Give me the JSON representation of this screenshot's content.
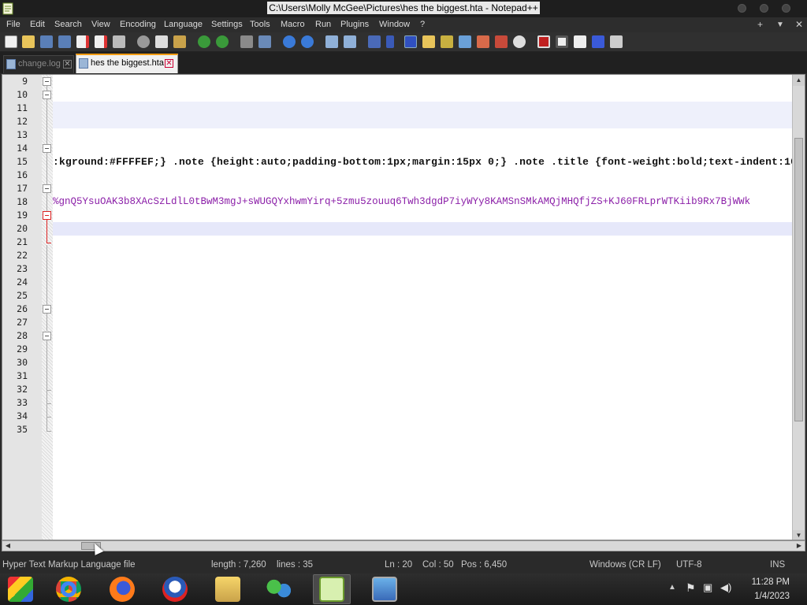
{
  "window": {
    "title": "C:\\Users\\Molly McGee\\Pictures\\hes the biggest.hta - Notepad++"
  },
  "menu": {
    "items": [
      "File",
      "Edit",
      "Search",
      "View",
      "Encoding",
      "Language",
      "Settings",
      "Tools",
      "Macro",
      "Run",
      "Plugins",
      "Window",
      "?"
    ],
    "right": [
      "+",
      "▼",
      "✕"
    ]
  },
  "tabs": [
    {
      "label": "change.log",
      "active": false
    },
    {
      "label": "hes the biggest.hta",
      "active": true
    }
  ],
  "editor": {
    "line_numbers": [
      "9",
      "10",
      "11",
      "12",
      "13",
      "14",
      "15",
      "16",
      "17",
      "18",
      "19",
      "20",
      "21",
      "22",
      "23",
      "24",
      "25",
      "26",
      "27",
      "28",
      "29",
      "30",
      "31",
      "32",
      "33",
      "34",
      "35"
    ],
    "lines": {
      "15": ":kground:#FFFFEF;} .note {height:auto;padding-bottom:1px;margin:15px 0;} .note .title {font-weight:bold;text-indent:10",
      "18": "%gnQ5YsuOAK3b8XAcSzLdlL0tBwM3mgJ+sWUGQYxhwmYirq+5zmu5zouuq6Twh3dgdP7iyWYy8KAMSnSMkAMQjMHQfjZS+KJ60FRLprWTKiib9Rx7BjWWk"
    }
  },
  "status": {
    "file_type": "Hyper Text Markup Language file",
    "length": "length : 7,260",
    "lines": "lines : 35",
    "ln": "Ln : 20",
    "col": "Col : 50",
    "pos": "Pos : 6,450",
    "eol": "Windows (CR LF)",
    "encoding": "UTF-8",
    "mode": "INS"
  },
  "taskbar": {
    "apps": [
      "mosaic-app",
      "chrome",
      "firefox",
      "obama-logo-app",
      "file-explorer",
      "network-users-app",
      "notepad-plus-plus",
      "computer-app"
    ],
    "time": "11:28 PM",
    "date": "1/4/2023"
  },
  "colors": {
    "accent": "#f39c12",
    "b64_text": "#8b1fa8",
    "current_line": "#e6e8fa"
  }
}
